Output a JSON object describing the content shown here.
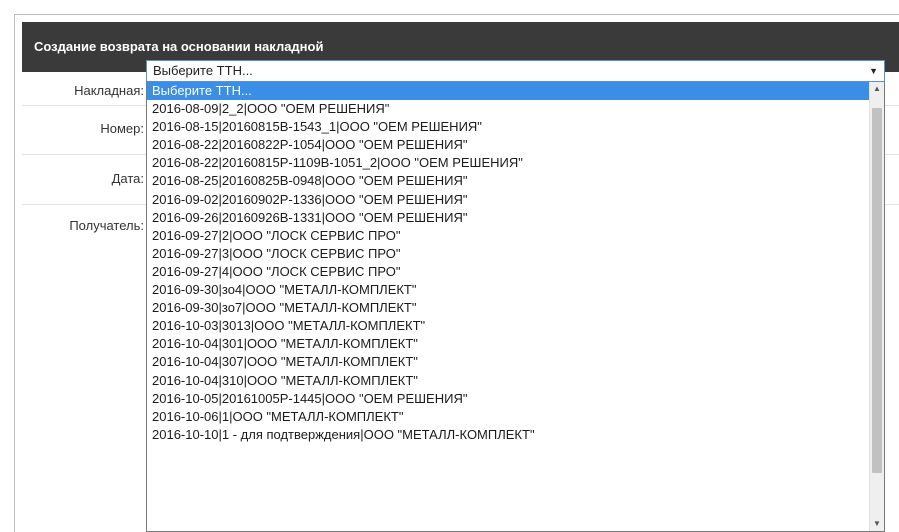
{
  "dialog": {
    "title": "Создание возврата на основании накладной"
  },
  "form": {
    "invoice_label": "Накладная:",
    "number_label": "Номер:",
    "date_label": "Дата:",
    "recipient_label": "Получатель:"
  },
  "invoice_select": {
    "value": "Выберите ТТН...",
    "options": [
      "Выберите ТТН...",
      "2016-08-09|2_2|ООО \"ОЕМ РЕШЕНИЯ\"",
      "2016-08-15|20160815B-1543_1|ООО \"ОЕМ РЕШЕНИЯ\"",
      "2016-08-22|20160822P-1054|ООО \"ОЕМ РЕШЕНИЯ\"",
      "2016-08-22|20160815P-1109B-1051_2|ООО \"ОЕМ РЕШЕНИЯ\"",
      "2016-08-25|20160825B-0948|ООО \"ОЕМ РЕШЕНИЯ\"",
      "2016-09-02|20160902P-1336|ООО \"ОЕМ РЕШЕНИЯ\"",
      "2016-09-26|20160926B-1331|ООО \"ОЕМ РЕШЕНИЯ\"",
      "2016-09-27|2|ООО \"ЛОСК СЕРВИС ПРО\"",
      "2016-09-27|3|ООО \"ЛОСК СЕРВИС ПРО\"",
      "2016-09-27|4|ООО \"ЛОСК СЕРВИС ПРО\"",
      "2016-09-30|зо4|ООО \"МЕТАЛЛ-КОМПЛЕКТ\"",
      "2016-09-30|зо7|ООО \"МЕТАЛЛ-КОМПЛЕКТ\"",
      "2016-10-03|3013|ООО \"МЕТАЛЛ-КОМПЛЕКТ\"",
      "2016-10-04|301|ООО \"МЕТАЛЛ-КОМПЛЕКТ\"",
      "2016-10-04|307|ООО \"МЕТАЛЛ-КОМПЛЕКТ\"",
      "2016-10-04|310|ООО \"МЕТАЛЛ-КОМПЛЕКТ\"",
      "2016-10-05|20161005P-1445|ООО \"ОЕМ РЕШЕНИЯ\"",
      "2016-10-06|1|ООО \"МЕТАЛЛ-КОМПЛЕКТ\"",
      "2016-10-10|1 - для подтверждения|ООО \"МЕТАЛЛ-КОМПЛЕКТ\""
    ],
    "highlighted_index": 0
  },
  "icons": {
    "select_arrow": "chevron-down-icon",
    "scroll_up": "arrow-up-icon",
    "scroll_down": "arrow-down-icon"
  },
  "colors": {
    "titlebar_bg": "#3a3a3a",
    "highlight": "#3a8ee6",
    "select_border": "#5b8fd6"
  }
}
